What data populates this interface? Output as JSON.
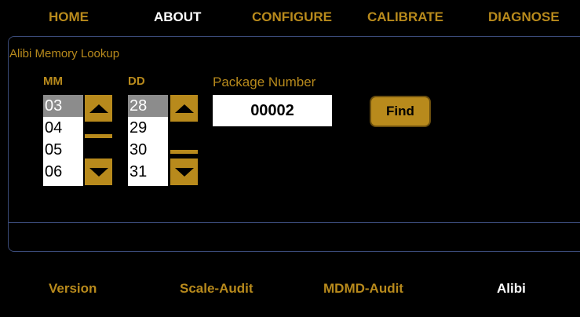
{
  "top_nav": {
    "items": [
      {
        "label": "HOME",
        "active": false
      },
      {
        "label": "ABOUT",
        "active": true
      },
      {
        "label": "CONFIGURE",
        "active": false
      },
      {
        "label": "CALIBRATE",
        "active": false
      },
      {
        "label": "DIAGNOSE",
        "active": false
      }
    ]
  },
  "panel": {
    "title": "Alibi Memory Lookup",
    "month": {
      "label": "MM",
      "options": [
        "03",
        "04",
        "05",
        "06"
      ],
      "selected": "03"
    },
    "day": {
      "label": "DD",
      "options": [
        "28",
        "29",
        "30",
        "31"
      ],
      "selected": "28"
    },
    "package": {
      "label": "Package Number",
      "value": "00002"
    },
    "find_label": "Find"
  },
  "bottom_nav": {
    "items": [
      {
        "label": "Version",
        "active": false
      },
      {
        "label": "Scale-Audit",
        "active": false
      },
      {
        "label": "MDMD-Audit",
        "active": false
      },
      {
        "label": "Alibi",
        "active": true
      }
    ]
  },
  "colors": {
    "accent": "#b88a1c",
    "active_text": "#ffffff",
    "background": "#000000",
    "border": "#3a4a78"
  },
  "icons": {
    "up": "triangle-up",
    "down": "triangle-down"
  }
}
